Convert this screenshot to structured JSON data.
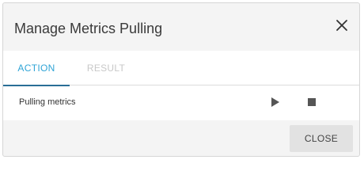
{
  "dialog": {
    "title": "Manage Metrics Pulling",
    "close_icon": "close-x-icon"
  },
  "tabs": [
    {
      "label": "ACTION",
      "active": true
    },
    {
      "label": "RESULT",
      "active": false
    }
  ],
  "action_row": {
    "label": "Pulling metrics",
    "play_icon": "play-icon",
    "stop_icon": "stop-icon"
  },
  "footer": {
    "close_label": "CLOSE"
  },
  "colors": {
    "active_tab_text": "#2fa4d6",
    "active_tab_indicator": "#2a6e96",
    "inactive_tab_text": "#c8c8c8",
    "dialog_bg": "#f4f4f4",
    "button_bg": "#e2e2e2"
  }
}
